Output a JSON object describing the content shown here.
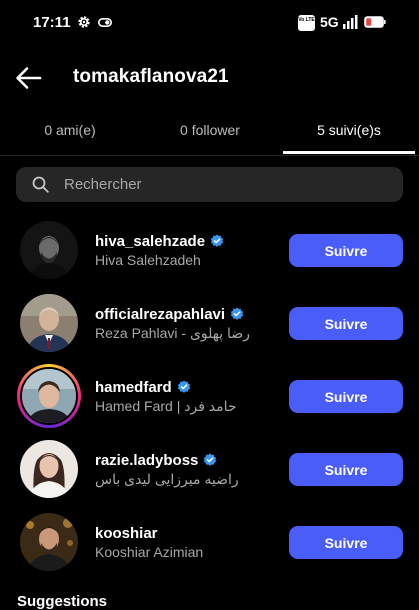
{
  "status_bar": {
    "time": "17:11",
    "network": "5G",
    "volte": "Vo LTE",
    "icons": [
      "gear-icon",
      "toggle-icon",
      "volte-icon",
      "signal-icon",
      "battery-low-icon"
    ],
    "battery_color": "#e04848"
  },
  "header": {
    "title": "tomakaflanova21",
    "back_icon": "arrow-left-icon"
  },
  "tabs": [
    {
      "label": "0 ami(e)",
      "active": false
    },
    {
      "label": "0 follower",
      "active": false
    },
    {
      "label": "5 suivi(e)s",
      "active": true
    }
  ],
  "search": {
    "placeholder": "Rechercher",
    "value": ""
  },
  "users": [
    {
      "username": "hiva_salehzade",
      "full_name": "Hiva Salehzadeh",
      "verified": true,
      "has_story": false,
      "follow_label": "Suivre"
    },
    {
      "username": "officialrezapahlavi",
      "full_name": "Reza Pahlavi - رضا پهلوی",
      "verified": true,
      "has_story": false,
      "follow_label": "Suivre"
    },
    {
      "username": "hamedfard",
      "full_name": "Hamed Fard | حامد فرد",
      "verified": true,
      "has_story": true,
      "follow_label": "Suivre"
    },
    {
      "username": "razie.ladyboss",
      "full_name": "راضیه میرزایی لیدی باس",
      "verified": true,
      "has_story": false,
      "follow_label": "Suivre"
    },
    {
      "username": "kooshiar",
      "full_name": "Kooshiar Azimian",
      "verified": false,
      "has_story": false,
      "follow_label": "Suivre"
    }
  ],
  "section": {
    "suggestions_label": "Suggestions"
  },
  "colors": {
    "background": "#000000",
    "accent": "#4a5df9",
    "verified": "#3897f0",
    "secondary_text": "#a8a8a8",
    "search_bg": "#262626"
  }
}
